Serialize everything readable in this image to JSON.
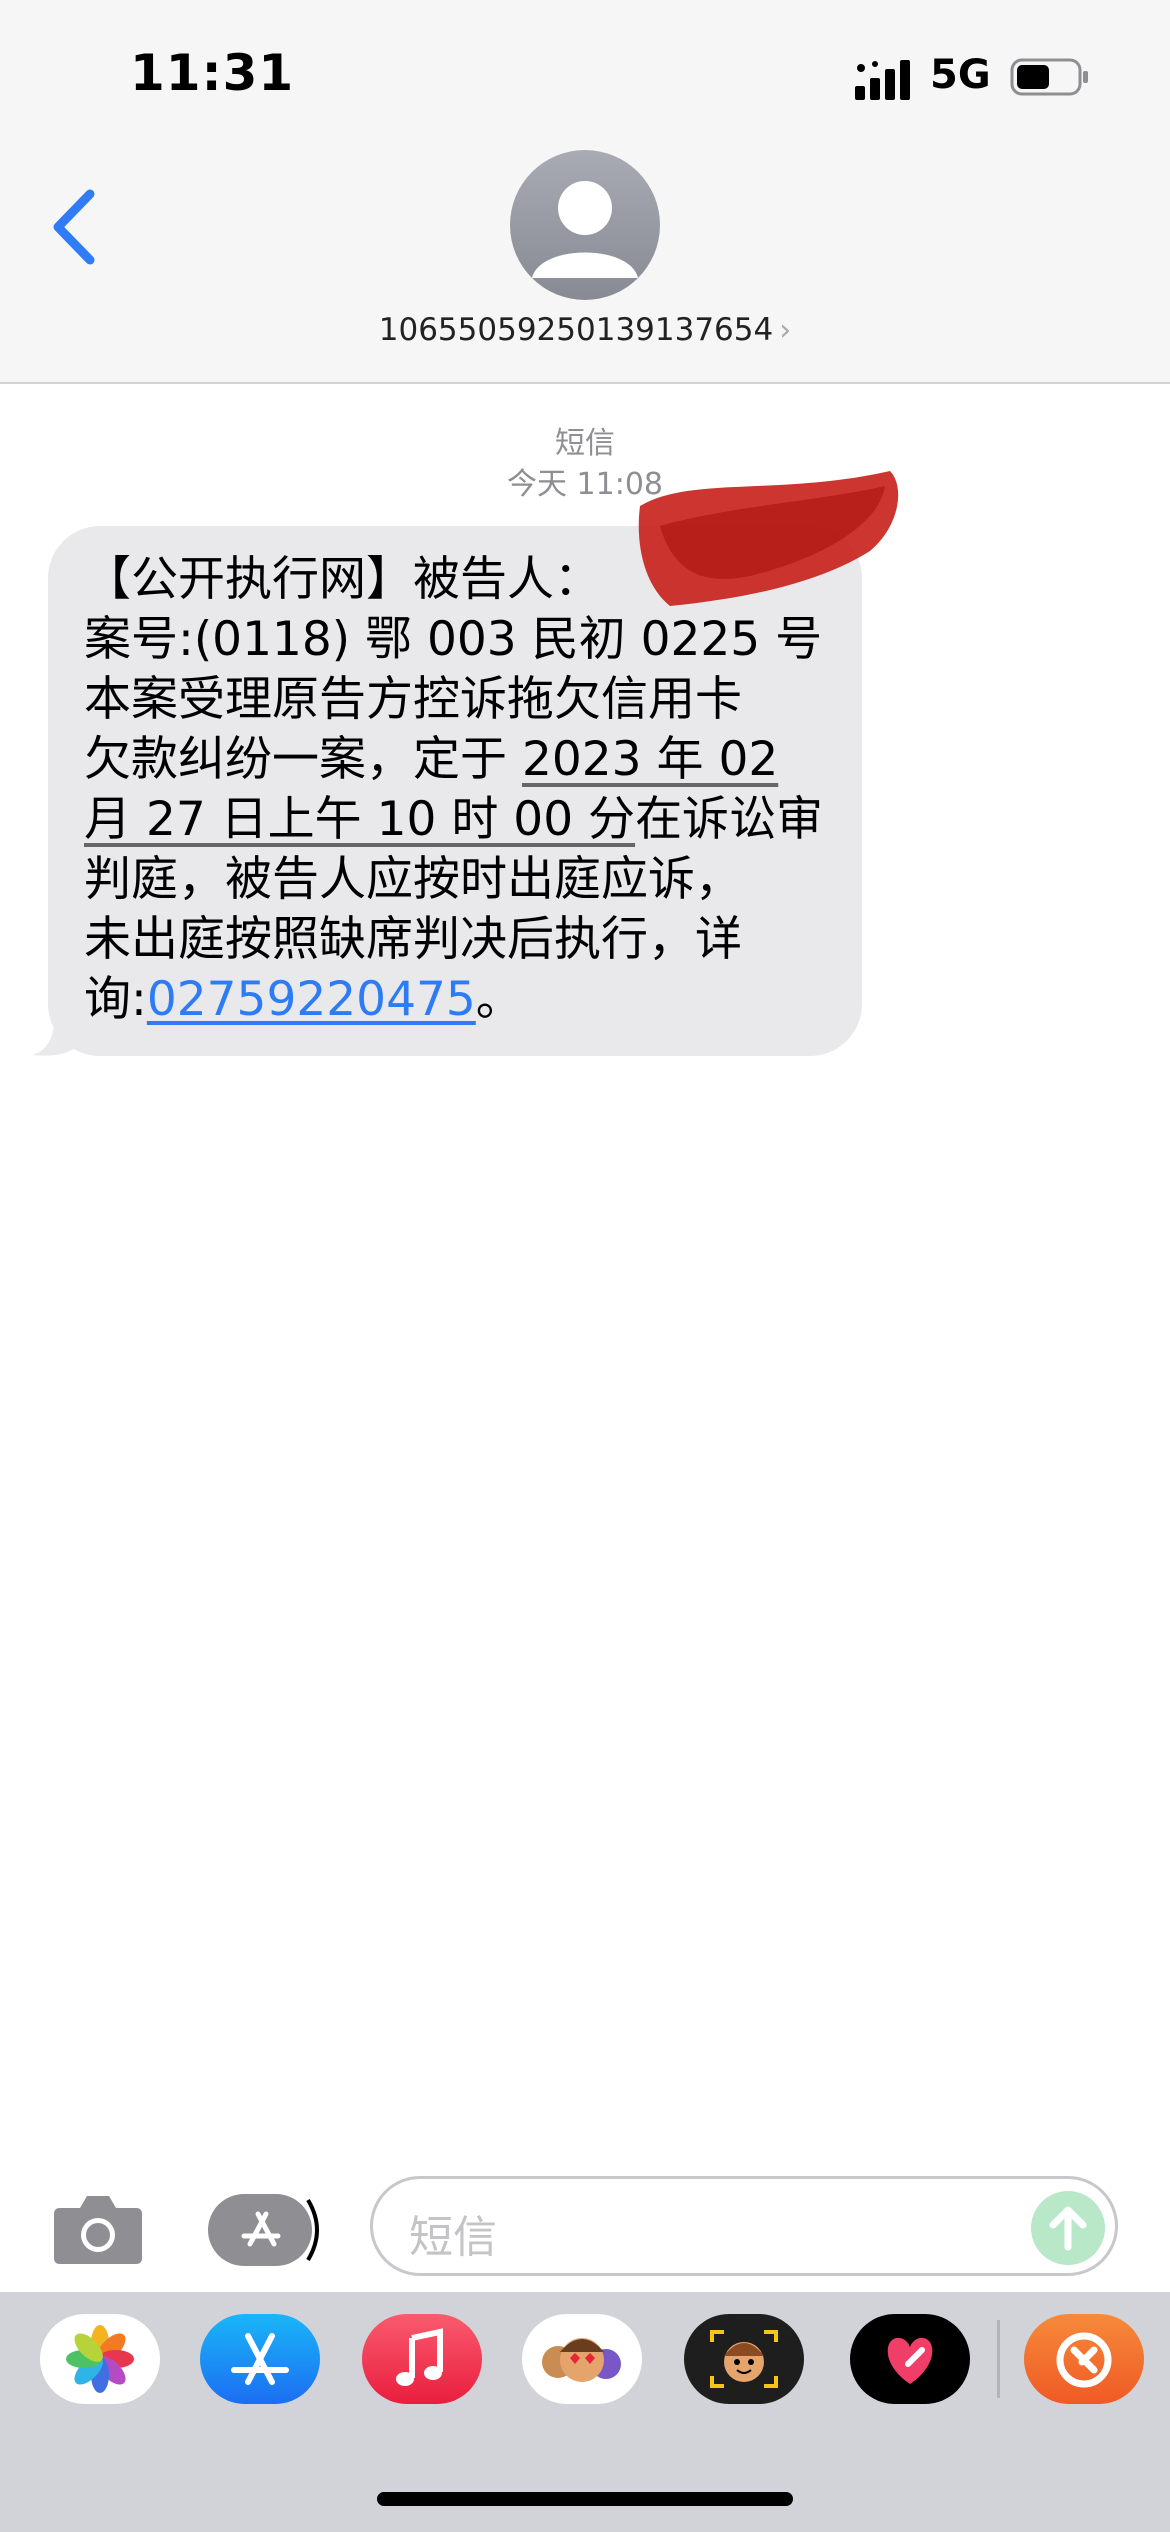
{
  "status_bar": {
    "time": "11:31",
    "network": "5G",
    "battery_level": 0.55,
    "signal_icon": "cellular-signal-icon",
    "battery_icon": "battery-icon"
  },
  "header": {
    "back_icon": "chevron-left-icon",
    "avatar_icon": "person-icon",
    "contact": "10655059250139137654",
    "contact_chevron": "›"
  },
  "conversation": {
    "service_label": "短信",
    "timestamp": "今天 11:08",
    "message": {
      "line1": "【公开执行网】被告人：",
      "line2": "案号:(0118) 鄂 003 民初 0225 号",
      "line3": "本案受理原告方控诉拖欠信用卡",
      "line4_a": "欠款纠纷一案，定于 ",
      "line4_b": "2023 年 02",
      "line5_a": "月 27 日上午 10 时 00 分",
      "line5_b": "在诉讼审",
      "line6": "判庭，被告人应按时出庭应诉，",
      "line7": "未出庭按照缺席判决后执行，详",
      "line8_a": "询:",
      "line8_link": "02759220475",
      "line8_b": "。"
    }
  },
  "input_bar": {
    "camera_icon": "camera-icon",
    "apps_icon": "app-store-icon",
    "placeholder": "短信",
    "send_icon": "arrow-up-icon"
  },
  "app_drawer": {
    "apps": [
      "photos-icon",
      "app-store-icon",
      "music-icon",
      "memoji-stickers-icon",
      "memoji-camera-icon",
      "digital-touch-icon",
      "third-party-app-icon"
    ]
  },
  "colors": {
    "bubble": "#e9e9eb",
    "link": "#2d7cf6",
    "ios_blue": "#2f7cf6",
    "drawer_bg": "#d2d3d8"
  }
}
